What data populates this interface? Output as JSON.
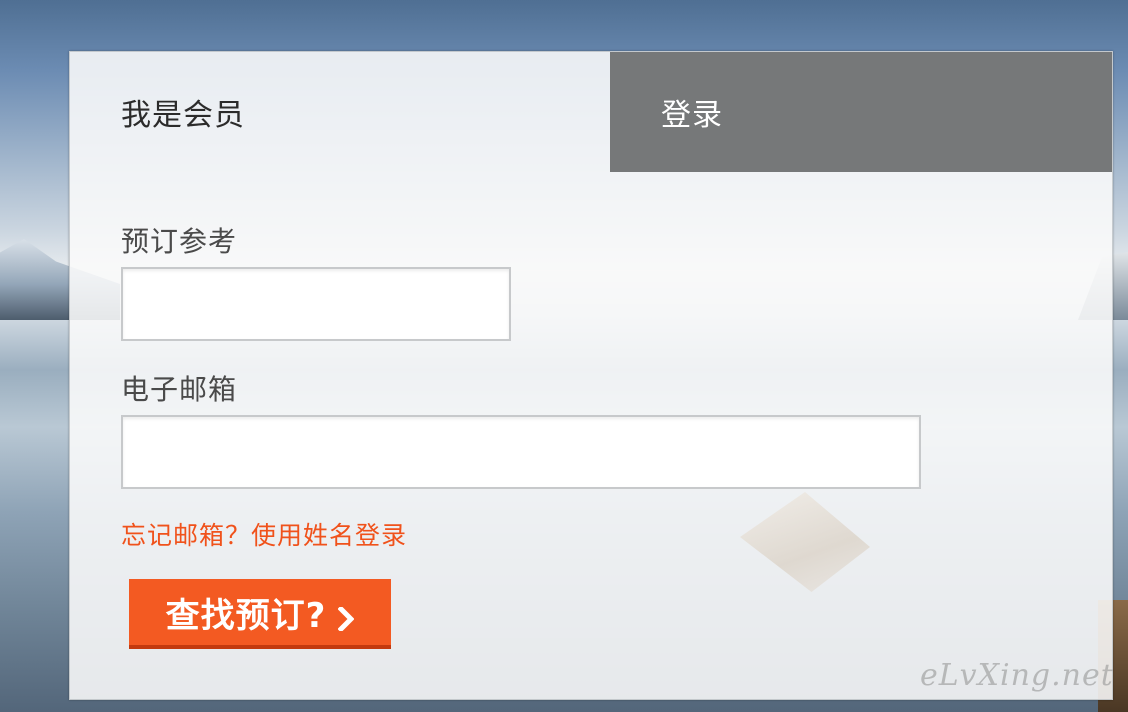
{
  "tabs": {
    "member_label": "我是会员",
    "login_label": "登录"
  },
  "form": {
    "booking_ref_label": "预订参考",
    "booking_ref_value": "",
    "email_label": "电子邮箱",
    "email_value": "",
    "forgot_link": "忘记邮箱？使用姓名登录",
    "find_button_label": "查找预订?",
    "find_button_icon": "chevron-right-icon"
  },
  "watermark": "eLvXing.net",
  "colors": {
    "accent": "#f35a22",
    "link": "#f0521b",
    "login_tab_bg": "#767879"
  }
}
